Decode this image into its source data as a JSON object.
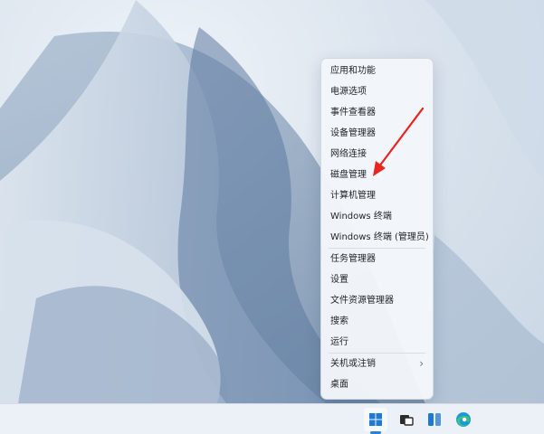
{
  "context_menu": {
    "items": [
      {
        "label": "应用和功能"
      },
      {
        "label": "电源选项"
      },
      {
        "label": "事件查看器"
      },
      {
        "label": "设备管理器"
      },
      {
        "label": "网络连接"
      },
      {
        "label": "磁盘管理"
      },
      {
        "label": "计算机管理"
      },
      {
        "label": "Windows 终端"
      },
      {
        "label": "Windows 终端 (管理员)"
      },
      {
        "label": "任务管理器"
      },
      {
        "label": "设置"
      },
      {
        "label": "文件资源管理器"
      },
      {
        "label": "搜索"
      },
      {
        "label": "运行"
      },
      {
        "label": "关机或注销",
        "submenu_glyph": "›"
      },
      {
        "label": "桌面"
      }
    ]
  },
  "annotation": {
    "color": "#e8251f",
    "points_to": "磁盘管理"
  },
  "taskbar": {
    "icons": [
      "windows-start-icon",
      "task-view-icon",
      "widgets-icon",
      "edge-browser-icon"
    ],
    "accent": "#2f7fd6"
  },
  "colors": {
    "menu_bg": "#f3f6fa",
    "wallpaper": "#c9d6e4"
  }
}
